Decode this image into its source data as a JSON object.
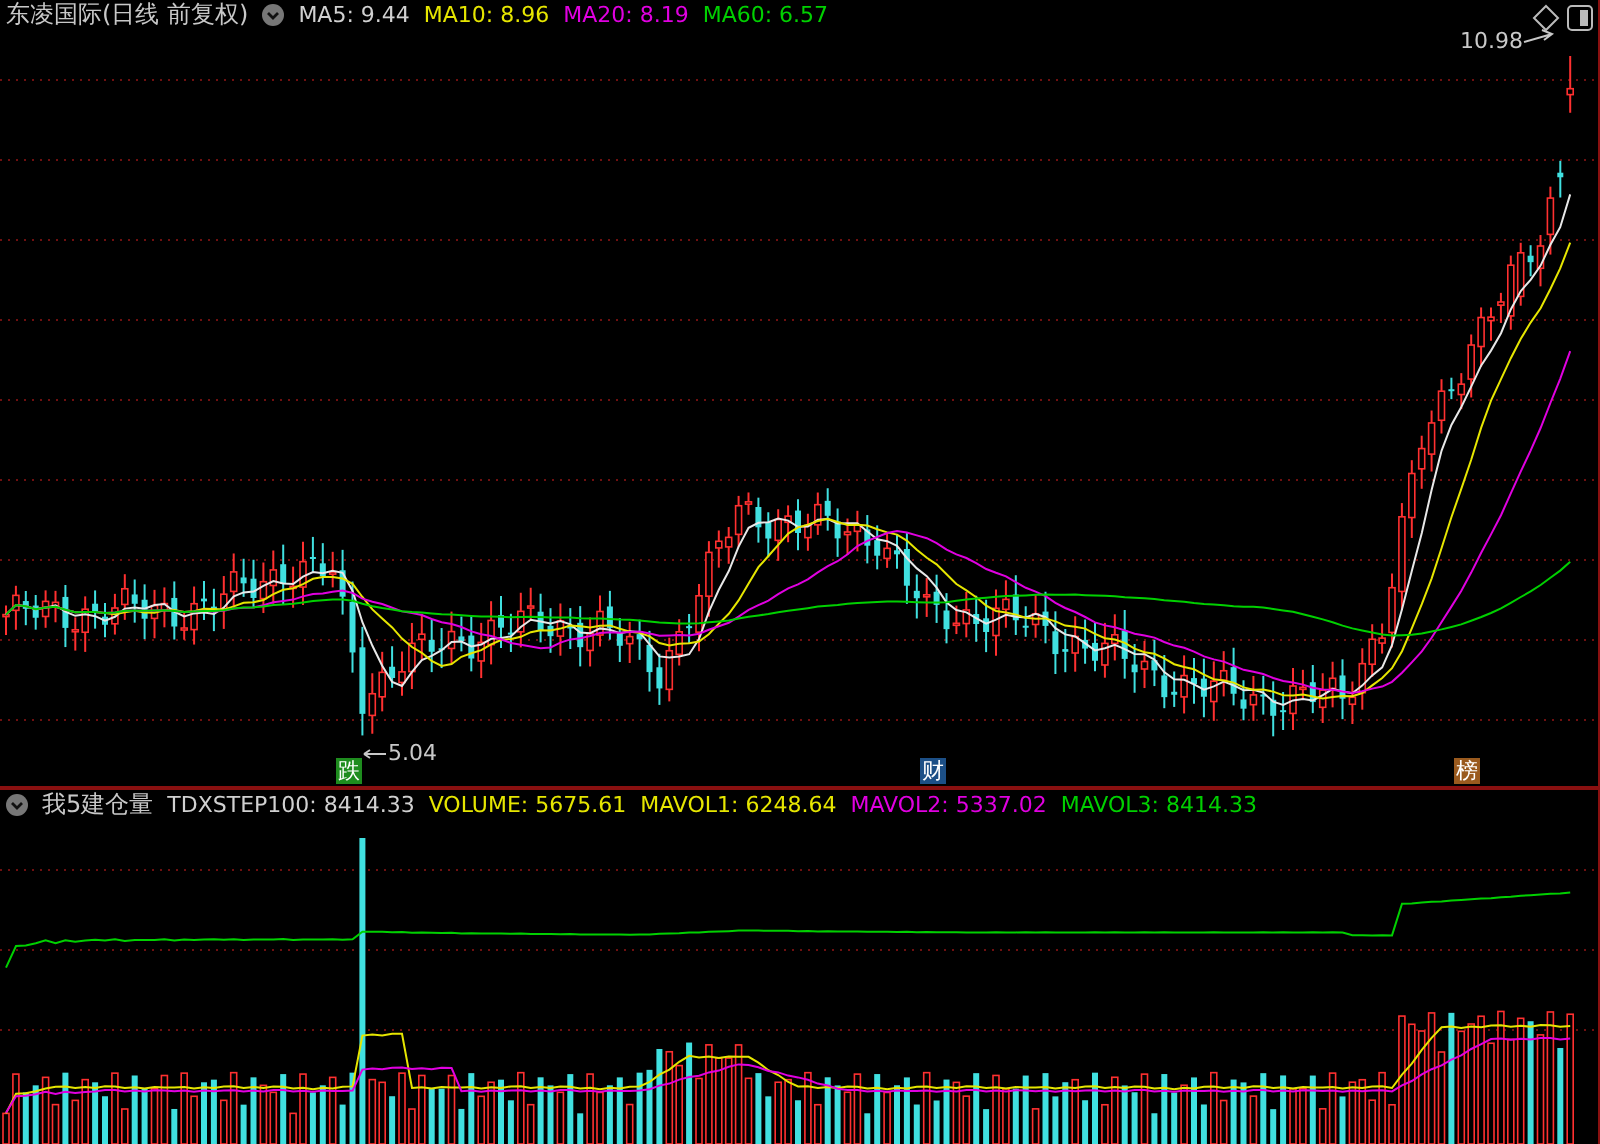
{
  "price_panel": {
    "title": "东凌国际(日线 前复权)",
    "indicators": [
      {
        "label": "MA5: 9.44",
        "color": "#d0d0d0"
      },
      {
        "label": "MA10: 8.96",
        "color": "#e6e600"
      },
      {
        "label": "MA20: 8.19",
        "color": "#e000e0"
      },
      {
        "label": "MA60: 6.57",
        "color": "#00d000"
      }
    ],
    "high_label": "10.98",
    "low_label": "5.04",
    "event_tags": [
      {
        "text": "跌",
        "color": "#1e8c1e"
      },
      {
        "text": "财",
        "color": "#1c4f86"
      },
      {
        "text": "榜",
        "color": "#9a5a1e"
      }
    ]
  },
  "volume_panel": {
    "title": "我5建仓量",
    "indicators": [
      {
        "label": "TDXSTEP100: 8414.33",
        "color": "#d0d0d0"
      },
      {
        "label": "VOLUME: 5675.61",
        "color": "#e6e600"
      },
      {
        "label": "MAVOL1: 6248.64",
        "color": "#e6e600"
      },
      {
        "label": "MAVOL2: 5337.02",
        "color": "#e000e0"
      },
      {
        "label": "MAVOL3: 8414.33",
        "color": "#00d000"
      }
    ]
  }
}
